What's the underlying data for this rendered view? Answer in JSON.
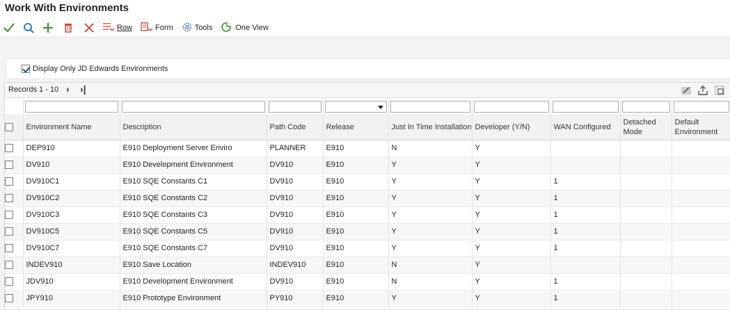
{
  "title": "Work With Environments",
  "toolbar": {
    "row_label": "Row",
    "form_label": "Form",
    "tools_label": "Tools",
    "oneview_label": "One View"
  },
  "filter": {
    "display_only_label": "Display Only JD Edwards Environments",
    "checked": true
  },
  "grid": {
    "records_label": "Records 1 - 10",
    "columns": [
      "Environment Name",
      "Description",
      "Path Code",
      "Release",
      "Just In Time Installation",
      "Developer (Y/N)",
      "WAN Configured",
      "Detached Mode",
      "Default Environment"
    ],
    "rows": [
      {
        "env": "DEP910",
        "desc": "E910 Deployment Server Enviro",
        "path": "PLANNER",
        "release": "E910",
        "jit": "N",
        "dev": "Y",
        "wan": "",
        "detached": "",
        "default": ""
      },
      {
        "env": "DV910",
        "desc": "E910 Development Environment",
        "path": "DV910",
        "release": "E910",
        "jit": "Y",
        "dev": "Y",
        "wan": "",
        "detached": "",
        "default": ""
      },
      {
        "env": "DV910C1",
        "desc": "E910 SQE Constants C1",
        "path": "DV910",
        "release": "E910",
        "jit": "Y",
        "dev": "Y",
        "wan": "1",
        "detached": "",
        "default": ""
      },
      {
        "env": "DV910C2",
        "desc": "E910 SQE Constants C2",
        "path": "DV910",
        "release": "E910",
        "jit": "Y",
        "dev": "Y",
        "wan": "1",
        "detached": "",
        "default": ""
      },
      {
        "env": "DV910C3",
        "desc": "E910 SQE Constants C3",
        "path": "DV910",
        "release": "E910",
        "jit": "Y",
        "dev": "Y",
        "wan": "1",
        "detached": "",
        "default": ""
      },
      {
        "env": "DV910C5",
        "desc": "E910 SQE Constants C5",
        "path": "DV910",
        "release": "E910",
        "jit": "Y",
        "dev": "Y",
        "wan": "1",
        "detached": "",
        "default": ""
      },
      {
        "env": "DV910C7",
        "desc": "E910 SQE Constants C7",
        "path": "DV910",
        "release": "E910",
        "jit": "Y",
        "dev": "Y",
        "wan": "1",
        "detached": "",
        "default": ""
      },
      {
        "env": "INDEV910",
        "desc": "E910 Save Location",
        "path": "INDEV910",
        "release": "E910",
        "jit": "N",
        "dev": "Y",
        "wan": "",
        "detached": "",
        "default": ""
      },
      {
        "env": "JDV910",
        "desc": "E910 Development Environment",
        "path": "DV910",
        "release": "E910",
        "jit": "N",
        "dev": "Y",
        "wan": "1",
        "detached": "",
        "default": ""
      },
      {
        "env": "JPY910",
        "desc": "E910 Prototype Environment",
        "path": "PY910",
        "release": "E910",
        "jit": "Y",
        "dev": "Y",
        "wan": "1",
        "detached": "",
        "default": ""
      }
    ]
  },
  "colors": {
    "ok_green": "#3a8a2e",
    "search_blue": "#2a6ebb",
    "delete_red": "#d43a2a",
    "link_blue": "#2a6ebb"
  },
  "icons": [
    "ok-check-icon",
    "search-icon",
    "add-icon",
    "delete-icon",
    "cancel-x-icon",
    "row-menu-icon",
    "form-menu-icon",
    "tools-gear-icon",
    "one-view-icon",
    "next-page-icon",
    "last-page-icon",
    "grid-edit-icon",
    "export-icon",
    "grid-format-icon"
  ]
}
